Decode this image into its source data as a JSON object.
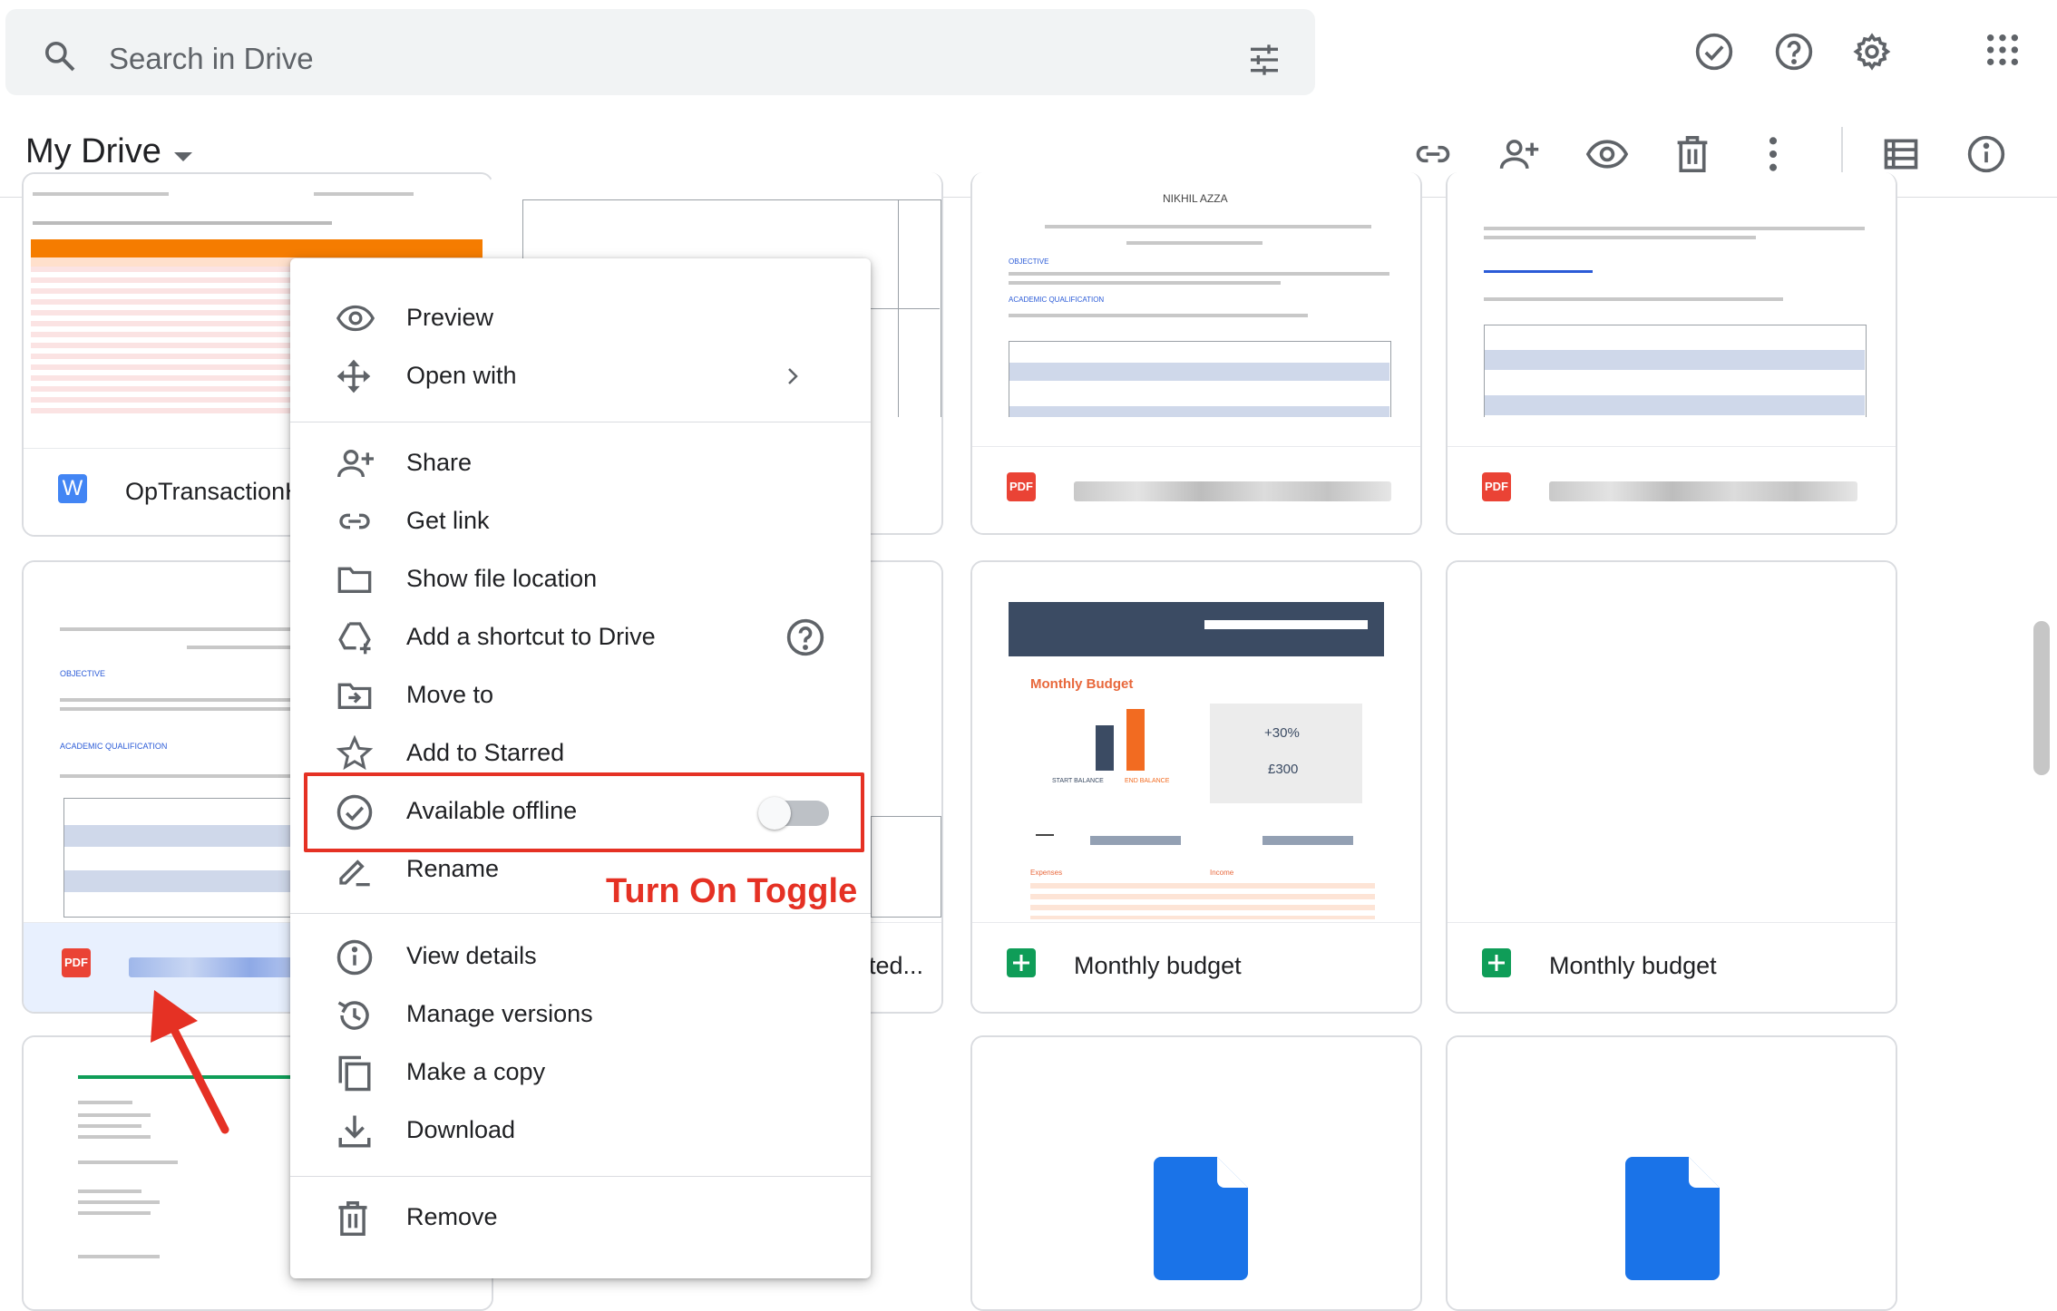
{
  "search": {
    "placeholder": "Search in Drive"
  },
  "header": {
    "title": "My Drive"
  },
  "files": [
    {
      "name": "OpTransactionH",
      "type": "word"
    },
    {
      "name": "",
      "type": "pdf"
    },
    {
      "name": "",
      "type": "pdf"
    },
    {
      "name": "",
      "type": "pdf"
    },
    {
      "name": "ted...",
      "type": "doc"
    },
    {
      "name": "Monthly budget",
      "type": "sheet"
    },
    {
      "name": "Monthly budget",
      "type": "sheet"
    }
  ],
  "thumbs": {
    "budget_title": "Monthly Budget",
    "budget_pct": "+30%",
    "budget_amount": "£300",
    "start_balance": "START BALANCE",
    "end_balance": "END BALANCE",
    "objective": "OBJECTIVE",
    "academic": "ACADEMIC QUALIFICATION",
    "resume_name": "NIKHIL AZZA",
    "expenses": "Expenses",
    "income": "Income"
  },
  "menu": {
    "preview": "Preview",
    "open_with": "Open with",
    "share": "Share",
    "get_link": "Get link",
    "show_location": "Show file location",
    "add_shortcut": "Add a shortcut to Drive",
    "move_to": "Move to",
    "add_starred": "Add to Starred",
    "available_offline": "Available offline",
    "available_offline_on": false,
    "rename": "Rename",
    "view_details": "View details",
    "manage_versions": "Manage versions",
    "make_copy": "Make a copy",
    "download": "Download",
    "remove": "Remove"
  },
  "annotation": {
    "text": "Turn On Toggle"
  },
  "colors": {
    "accent_red": "#e53124",
    "pdf": "#ea4335",
    "sheet": "#0f9d58",
    "doc": "#1a73e8"
  }
}
